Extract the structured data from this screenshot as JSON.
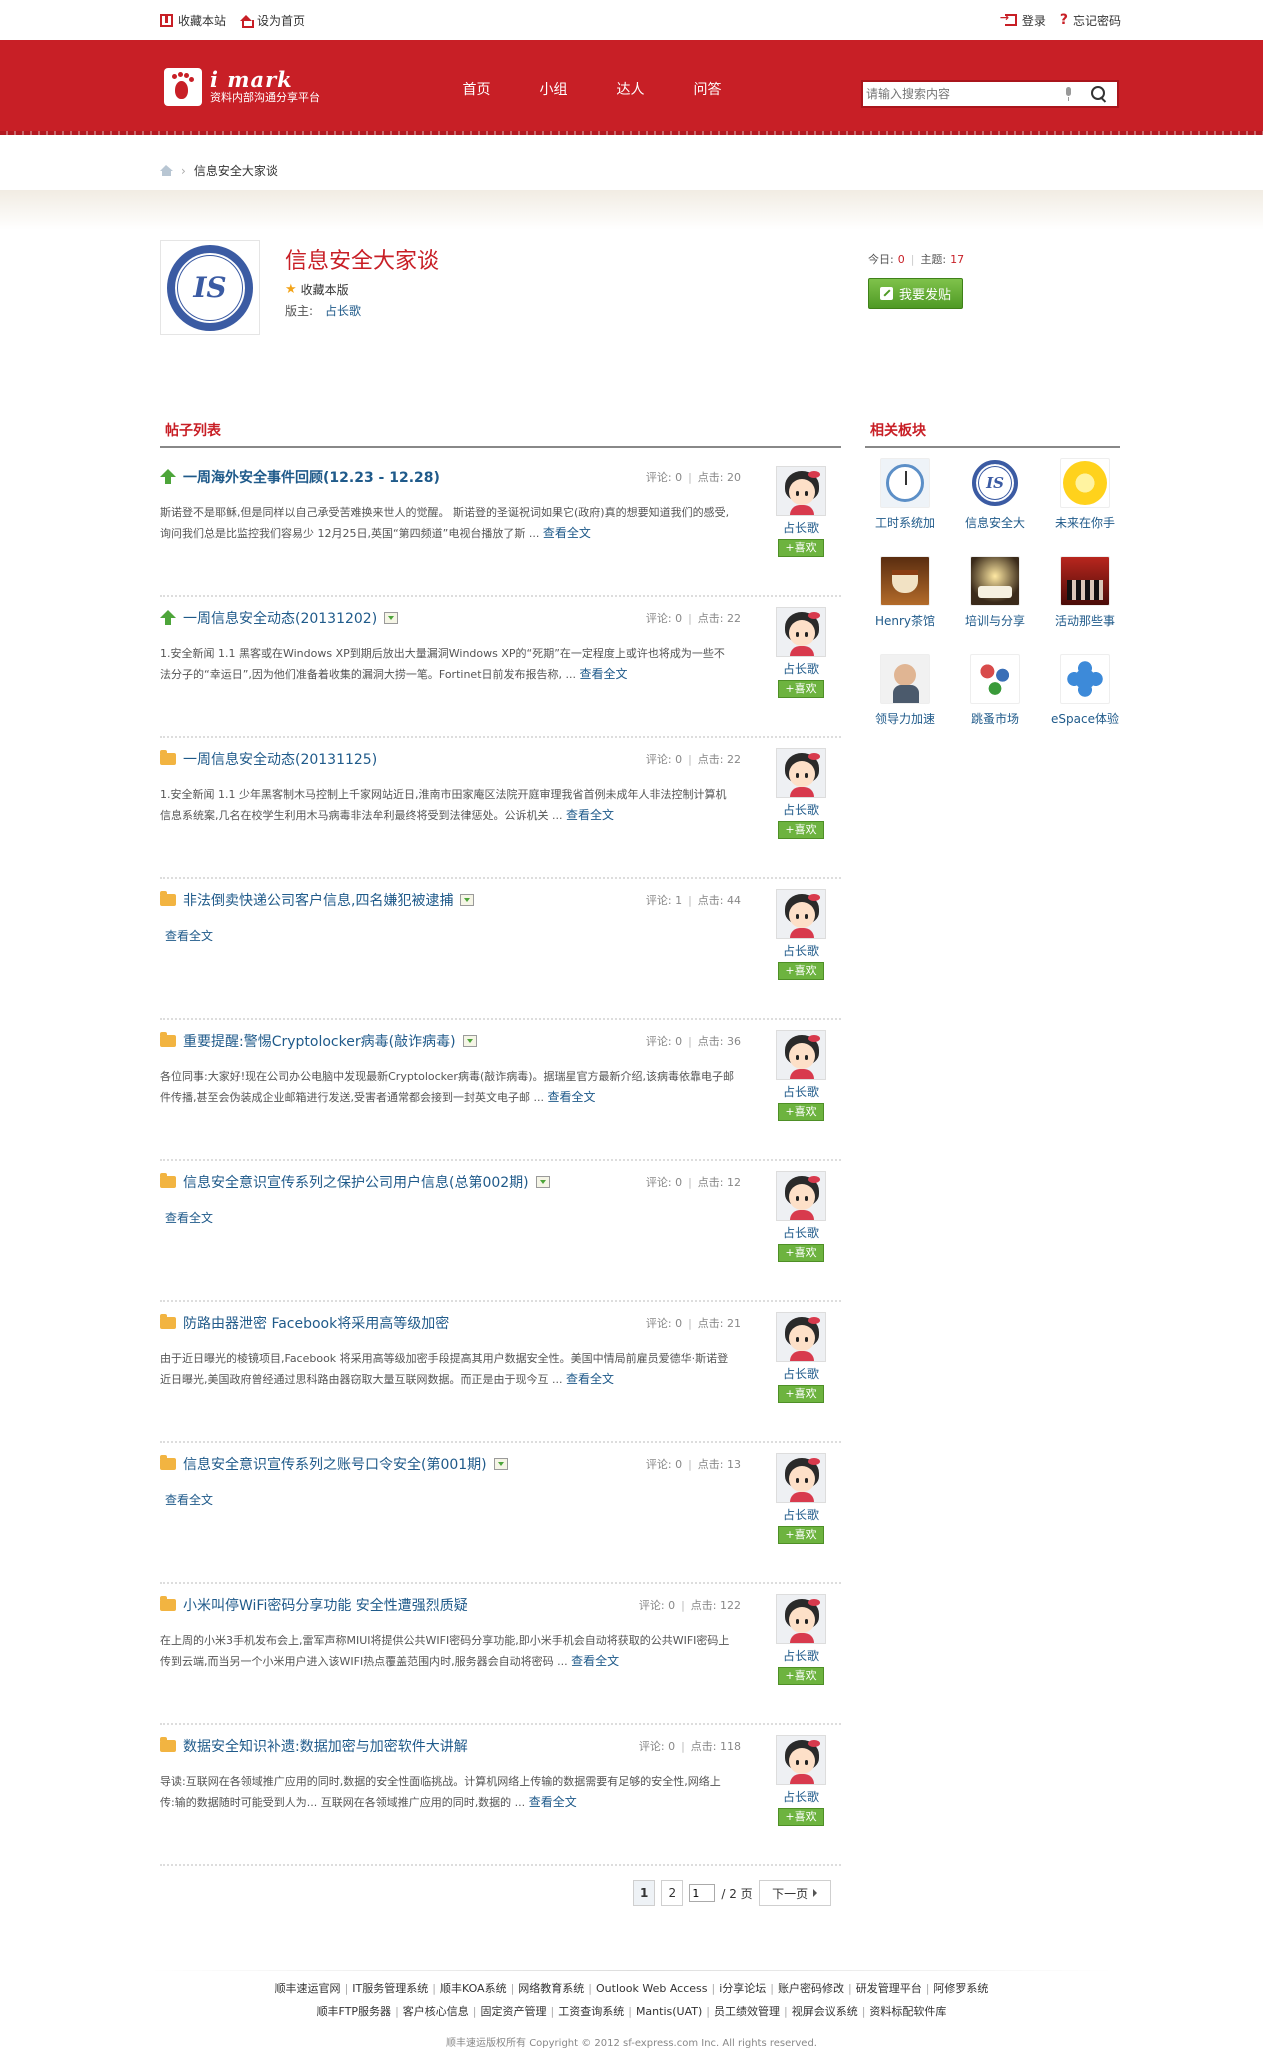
{
  "topbar": {
    "bookmark": "收藏本站",
    "set_home": "设为首页",
    "login": "登录",
    "forgot_password": "忘记密码"
  },
  "header": {
    "brand": "i mark",
    "slogan": "资料内部沟通分享平台",
    "nav": [
      "首页",
      "小组",
      "达人",
      "问答"
    ],
    "search_placeholder": "请输入搜索内容"
  },
  "breadcrumb": {
    "current": "信息安全大家谈"
  },
  "forum": {
    "logo_text": "IS",
    "title": "信息安全大家谈",
    "favorite_label": "收藏本版",
    "moderator_label": "版主:",
    "moderator_name": "占长歌",
    "today_label": "今日:",
    "today_count": "0",
    "topics_label": "主题:",
    "topics_count": "17",
    "post_button": "我要发贴"
  },
  "post_list": {
    "section_title": "帖子列表",
    "comments_label": "评论:",
    "views_label": "点击:",
    "read_more": "查看全文",
    "author_name": "占长歌",
    "like_button": "+喜欢",
    "posts": [
      {
        "title": "一周海外安全事件回顾(12.23 - 12.28)",
        "icon": "up-arrow-icon",
        "attachment": false,
        "comments": "0",
        "views": "20",
        "excerpt": "斯诺登不是耶稣,但是同样以自己承受苦难换来世人的觉醒。 斯诺登的圣诞祝词如果它(政府)真的想要知道我们的感受,询问我们总是比监控我们容易少 12月25日,英国“第四频道”电视台播放了斯 ..."
      },
      {
        "title": "一周信息安全动态(20131202)",
        "icon": "up-arrow-icon",
        "attachment": true,
        "comments": "0",
        "views": "22",
        "excerpt": "1.安全新闻 1.1 黑客或在Windows XP到期后放出大量漏洞Windows XP的“死期”在一定程度上或许也将成为一些不法分子的“幸运日”,因为他们准备着收集的漏洞大捞一笔。Fortinet日前发布报告称, ..."
      },
      {
        "title": "一周信息安全动态(20131125)",
        "icon": "folder-icon",
        "attachment": false,
        "comments": "0",
        "views": "22",
        "excerpt": "1.安全新闻 1.1 少年黑客制木马控制上千家网站近日,淮南市田家庵区法院开庭审理我省首例未成年人非法控制计算机信息系统案,几名在校学生利用木马病毒非法牟利最终将受到法律惩处。公诉机关 ..."
      },
      {
        "title": "非法倒卖快递公司客户信息,四名嫌犯被逮捕",
        "icon": "folder-icon",
        "attachment": true,
        "comments": "1",
        "views": "44",
        "excerpt": ""
      },
      {
        "title": "重要提醒:警惕Cryptolocker病毒(敲诈病毒)",
        "icon": "folder-icon",
        "attachment": true,
        "comments": "0",
        "views": "36",
        "excerpt": "各位同事:大家好!现在公司办公电脑中发现最新Cryptolocker病毒(敲诈病毒)。据瑞星官方最新介绍,该病毒依靠电子邮件传播,甚至会伪装成企业邮箱进行发送,受害者通常都会接到一封英文电子邮 ..."
      },
      {
        "title": "信息安全意识宣传系列之保护公司用户信息(总第002期)",
        "icon": "folder-icon",
        "attachment": true,
        "comments": "0",
        "views": "12",
        "excerpt": ""
      },
      {
        "title": "防路由器泄密 Facebook将采用高等级加密",
        "icon": "folder-icon",
        "attachment": false,
        "comments": "0",
        "views": "21",
        "excerpt": "由于近日曝光的棱镜项目,Facebook 将采用高等级加密手段提高其用户数据安全性。美国中情局前雇员爱德华·斯诺登近日曝光,美国政府曾经通过思科路由器窃取大量互联网数据。而正是由于现今互 ..."
      },
      {
        "title": "信息安全意识宣传系列之账号口令安全(第001期)",
        "icon": "folder-icon",
        "attachment": true,
        "comments": "0",
        "views": "13",
        "excerpt": ""
      },
      {
        "title": "小米叫停WiFi密码分享功能 安全性遭强烈质疑",
        "icon": "folder-icon",
        "attachment": false,
        "comments": "0",
        "views": "122",
        "excerpt": "在上周的小米3手机发布会上,雷军声称MIUI将提供公共WIFI密码分享功能,即小米手机会自动将获取的公共WIFI密码上传到云端,而当另一个小米用户进入该WIFI热点覆盖范围内时,服务器会自动将密码 ..."
      },
      {
        "title": "数据安全知识补遗:数据加密与加密软件大讲解",
        "icon": "folder-icon",
        "attachment": false,
        "comments": "0",
        "views": "118",
        "excerpt": "导读:互联网在各领域推广应用的同时,数据的安全性面临挑战。计算机网络上传输的数据需要有足够的安全性,网络上传:输的数据随时可能受到人为... 互联网在各领域推广应用的同时,数据的 ..."
      }
    ]
  },
  "related": {
    "section_title": "相关板块",
    "boards": [
      {
        "label": "工时系统加",
        "icon": "clock-calendar-icon"
      },
      {
        "label": "信息安全大",
        "icon": "is-badge-icon"
      },
      {
        "label": "未来在你手",
        "icon": "lemon-icon"
      },
      {
        "label": "Henry茶馆",
        "icon": "tea-cup-icon"
      },
      {
        "label": "培训与分享",
        "icon": "book-light-icon"
      },
      {
        "label": "活动那些事",
        "icon": "group-activity-icon"
      },
      {
        "label": "领导力加速",
        "icon": "leader-portrait-icon"
      },
      {
        "label": "跳蚤市场",
        "icon": "market-people-icon"
      },
      {
        "label": "eSpace体验",
        "icon": "espace-logo-icon"
      }
    ]
  },
  "pagination": {
    "pages": [
      "1",
      "2"
    ],
    "current": "1",
    "input_value": "1",
    "total_text": "/ 2 页",
    "next": "下一页"
  },
  "footer": {
    "row1": [
      "顺丰速运官网",
      "IT服务管理系统",
      "顺丰KOA系统",
      "网络教育系统",
      "Outlook Web Access",
      "i分享论坛",
      "账户密码修改",
      "研发管理平台",
      "阿修罗系统"
    ],
    "row2": [
      "顺丰FTP服务器",
      "客户核心信息",
      "固定资产管理",
      "工资查询系统",
      "Mantis(UAT)",
      "员工绩效管理",
      "视屏会议系统",
      "资料标配软件库"
    ],
    "copyright": "顺丰速运版权所有 Copyright © 2012 sf-express.com Inc. All rights reserved."
  },
  "colors": {
    "brand_red": "#c81f26",
    "link_blue": "#1f5a8a",
    "button_green": "#6db33f"
  }
}
